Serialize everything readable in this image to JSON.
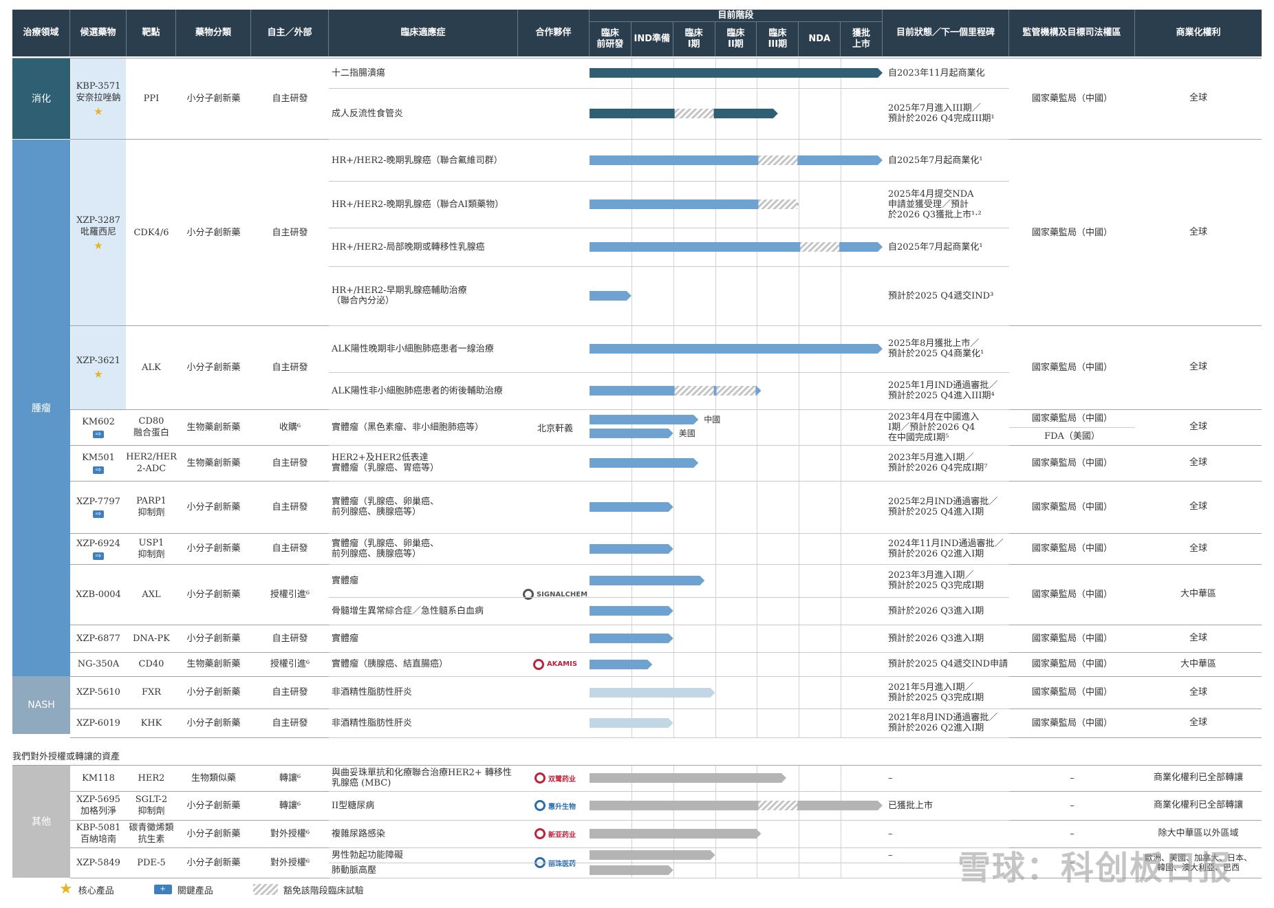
{
  "headers": {
    "area": "治療領域",
    "candidate": "候選藥物",
    "target": "靶點",
    "drug_class": "藥物分類",
    "origin": "自主／外部",
    "indication": "臨床適應症",
    "partner": "合作夥伴",
    "stage_group": "目前階段",
    "status": "目前狀態／下一個里程碑",
    "regulator": "監管機構及目標司法權區",
    "rights": "商業化權利"
  },
  "stages": [
    "臨床\n前研發",
    "IND準備",
    "臨床\nI期",
    "臨床\nII期",
    "臨床\nIII期",
    "NDA",
    "獲批\n上市"
  ],
  "areas": [
    {
      "name": "消化",
      "color": "#2e5f73"
    },
    {
      "name": "腫瘤",
      "color": "#5d97c9"
    },
    {
      "name": "NASH",
      "color": "#8fa9bf"
    },
    {
      "name": "其他",
      "color": "#bfbfbf"
    }
  ],
  "section_outlicensed": "我們對外授權或轉讓的資產",
  "colors": {
    "digest": "#2e5f73",
    "onc": "#6ea3d1",
    "nash": "#c3d6e4",
    "other": "#b4b4b4",
    "header": "#2b3e4e"
  },
  "drugs": [
    {
      "name": "KBP-3571\n安奈拉唑鈉",
      "target": "PPI",
      "cls": "小分子創新藥",
      "origin": "自主研發",
      "star": "★",
      "key": "",
      "regulator": "國家藥監局（中國）",
      "rights": "全球"
    },
    {
      "name": "XZP-3287\n吡羅西尼",
      "target": "CDK4/6",
      "cls": "小分子創新藥",
      "origin": "自主研發",
      "star": "★",
      "key": "",
      "regulator": "國家藥監局（中國）",
      "rights": "全球"
    },
    {
      "name": "XZP-3621",
      "target": "ALK",
      "cls": "小分子創新藥",
      "origin": "自主研發",
      "star": "★",
      "key": "",
      "regulator": "國家藥監局（中國）",
      "rights": "全球"
    },
    {
      "name": "KM602",
      "target": "CD80\n融合蛋白",
      "cls": "生物藥創新藥",
      "origin": "收購⁶",
      "star": "",
      "key": "⇨",
      "regulator": "國家藥監局（中國）",
      "regulator2": "FDA（美國）",
      "rights": "全球",
      "partner": "北京軒義"
    },
    {
      "name": "KM501",
      "target": "HER2/HER\n2-ADC",
      "cls": "生物藥創新藥",
      "origin": "自主研發",
      "star": "",
      "key": "⇨",
      "regulator": "國家藥監局（中國）",
      "rights": "全球"
    },
    {
      "name": "XZP-7797",
      "target": "PARP1\n抑制劑",
      "cls": "小分子創新藥",
      "origin": "自主研發",
      "star": "",
      "key": "⇨",
      "regulator": "國家藥監局（中國）",
      "rights": "全球"
    },
    {
      "name": "XZP-6924",
      "target": "USP1\n抑制劑",
      "cls": "小分子創新藥",
      "origin": "自主研發",
      "star": "",
      "key": "⇨",
      "regulator": "國家藥監局（中國）",
      "rights": "全球"
    },
    {
      "name": "XZB-0004",
      "target": "AXL",
      "cls": "小分子創新藥",
      "origin": "授權引進⁶",
      "star": "",
      "key": "",
      "regulator": "國家藥監局（中國）",
      "rights": "大中華區",
      "partner": "SIGNALCHEM"
    },
    {
      "name": "XZP-6877",
      "target": "DNA-PK",
      "cls": "小分子創新藥",
      "origin": "自主研發",
      "star": "",
      "key": "",
      "regulator": "國家藥監局（中國）",
      "rights": "全球"
    },
    {
      "name": "NG-350A",
      "target": "CD40",
      "cls": "生物藥創新藥",
      "origin": "授權引進⁶",
      "star": "",
      "key": "",
      "regulator": "國家藥監局（中國）",
      "rights": "大中華區",
      "partner": "AKAMIS"
    },
    {
      "name": "XZP-5610",
      "target": "FXR",
      "cls": "小分子創新藥",
      "origin": "自主研發",
      "star": "",
      "key": "",
      "regulator": "國家藥監局（中國）",
      "rights": "全球"
    },
    {
      "name": "XZP-6019",
      "target": "KHK",
      "cls": "小分子創新藥",
      "origin": "自主研發",
      "star": "",
      "key": "",
      "regulator": "國家藥監局（中國）",
      "rights": "全球"
    },
    {
      "name": "KM118",
      "target": "HER2",
      "cls": "生物類似藥",
      "origin": "轉讓⁶",
      "star": "",
      "key": "",
      "regulator": "–",
      "rights": "商業化權利已全部轉讓",
      "partner": "双鹭药业"
    },
    {
      "name": "XZP-5695\n加格列淨",
      "target": "SGLT-2\n抑制劑",
      "cls": "小分子創新藥",
      "origin": "轉讓⁶",
      "star": "",
      "key": "",
      "regulator": "–",
      "rights": "商業化權利已全部轉讓",
      "partner": "惠升生物"
    },
    {
      "name": "KBP-5081\n百納培南",
      "target": "碳青黴烯類\n抗生素",
      "cls": "小分子創新藥",
      "origin": "對外授權⁶",
      "star": "",
      "key": "",
      "regulator": "–",
      "rights": "除大中華區以外區域",
      "partner": "新亚药业"
    },
    {
      "name": "XZP-5849",
      "target": "PDE-5",
      "cls": "小分子創新藥",
      "origin": "對外授權⁶",
      "star": "",
      "key": "",
      "regulator": "–",
      "rights": "歐洲、美國、加拿大、日本、\n韓國、澳大利亞、巴西",
      "partner": "丽珠医药"
    }
  ],
  "indications": [
    {
      "text": "十二指腸潰瘍",
      "status": "自2023年11月起商業化",
      "progress": 7,
      "hatch": [],
      "color": "digest"
    },
    {
      "text": "成人反流性食管炎",
      "status": "2025年7月進入III期／\n預計於2026 Q4完成III期¹",
      "progress": 4.5,
      "hatch": [
        2
      ],
      "color": "digest"
    },
    {
      "text": "HR+/HER2-晚期乳腺癌（聯合氟維司群）",
      "status": "自2025年7月起商業化¹",
      "progress": 7,
      "hatch": [
        4
      ],
      "color": "onc"
    },
    {
      "text": "HR+/HER2-晚期乳腺癌（聯合AI類藥物）",
      "status": "2025年4月提交NDA\n申請並獲受理／預計\n於2026 Q3獲批上市¹·²",
      "progress": 5,
      "hatch": [
        4
      ],
      "color": "onc"
    },
    {
      "text": "HR+/HER2-局部晚期或轉移性乳腺癌",
      "status": "自2025年7月起商業化¹",
      "progress": 7,
      "hatch": [
        5
      ],
      "color": "onc"
    },
    {
      "text": "HR+/HER2-早期乳腺癌輔助治療\n（聯合內分泌）",
      "status": "預計於2025 Q4遞交IND³",
      "progress": 1,
      "hatch": [],
      "color": "onc"
    },
    {
      "text": "ALK陽性晚期非小細胞肺癌患者一線治療",
      "status": "2025年8月獲批上市／\n預計於2025 Q4商業化¹",
      "progress": 7,
      "hatch": [],
      "color": "onc"
    },
    {
      "text": "ALK陽性非小細胞肺癌患者的術後輔助治療",
      "status": "2025年1月IND通過審批／\n預計於2025 Q4進入III期⁴",
      "progress": 4.1,
      "hatch": [
        2,
        3
      ],
      "color": "onc"
    },
    {
      "text": "實體瘤（黑色素瘤、非小細胞肺癌等）",
      "status": "2023年4月在中國進入\nI期／預計於2026 Q4\n在中國完成I期⁵",
      "progress": 2.6,
      "progress2": 2,
      "region1": "中國",
      "region2": "美國",
      "hatch": [],
      "color": "onc"
    },
    {
      "text": "HER2+及HER2低表達\n實體瘤（乳腺癌、胃癌等）",
      "status": "2023年5月進入I期／\n預計於2026 Q4完成I期⁷",
      "progress": 2.6,
      "hatch": [],
      "color": "onc"
    },
    {
      "text": "實體瘤（乳腺癌、卵巢癌、\n前列腺癌、胰腺癌等）",
      "status": "2025年2月IND通過審批／\n預計於2025 Q4進入I期",
      "progress": 2,
      "hatch": [],
      "color": "onc"
    },
    {
      "text": "實體瘤（乳腺癌、卵巢癌、\n前列腺癌、胰腺癌等）",
      "status": "2024年11月IND通過審批／\n預計於2026 Q2進入I期",
      "progress": 2,
      "hatch": [],
      "color": "onc"
    },
    {
      "text": "實體瘤",
      "status": "2023年3月進入I期／\n預計於2025 Q3完成I期",
      "progress": 2.75,
      "hatch": [],
      "color": "onc"
    },
    {
      "text": "骨髓增生異常綜合症／急性髓系白血病",
      "status": "預計於2026 Q3進入I期",
      "progress": 2,
      "hatch": [],
      "color": "onc"
    },
    {
      "text": "實體瘤",
      "status": "預計於2026 Q3進入I期",
      "progress": 2,
      "hatch": [],
      "color": "onc"
    },
    {
      "text": "實體瘤（胰腺癌、結直腸癌）",
      "status": "預計於2025 Q4遞交IND申請",
      "progress": 1.5,
      "hatch": [],
      "color": "onc"
    },
    {
      "text": "非酒精性脂肪性肝炎",
      "status": "2021年5月進入I期／\n預計於2025 Q3完成I期",
      "progress": 3,
      "hatch": [],
      "color": "nash"
    },
    {
      "text": "非酒精性脂肪性肝炎",
      "status": "2021年8月IND通過審批／\n預計於2026 Q2進入I期",
      "progress": 2,
      "hatch": [],
      "color": "nash"
    },
    {
      "text": "與曲妥珠單抗和化療聯合治療HER2+ 轉移性\n乳腺癌 (MBC)",
      "status": "–",
      "progress": 4.7,
      "hatch": [],
      "color": "other"
    },
    {
      "text": "II型糖尿病",
      "status": "已獲批上市",
      "progress": 7,
      "hatch": [
        4
      ],
      "color": "other"
    },
    {
      "text": "複雜尿路感染",
      "status": "–",
      "progress": 4.1,
      "hatch": [],
      "color": "other"
    },
    {
      "text": "男性勃起功能障礙",
      "status": "–",
      "progress": 3,
      "hatch": [],
      "color": "other"
    },
    {
      "text": "肺動脈高壓",
      "status": "",
      "progress": 2,
      "hatch": [],
      "color": "other"
    }
  ],
  "legend": {
    "core": "核心產品",
    "key": "關鍵產品",
    "exempt": "豁免該階段臨床試驗"
  },
  "watermark": "雪球：科创板日报"
}
